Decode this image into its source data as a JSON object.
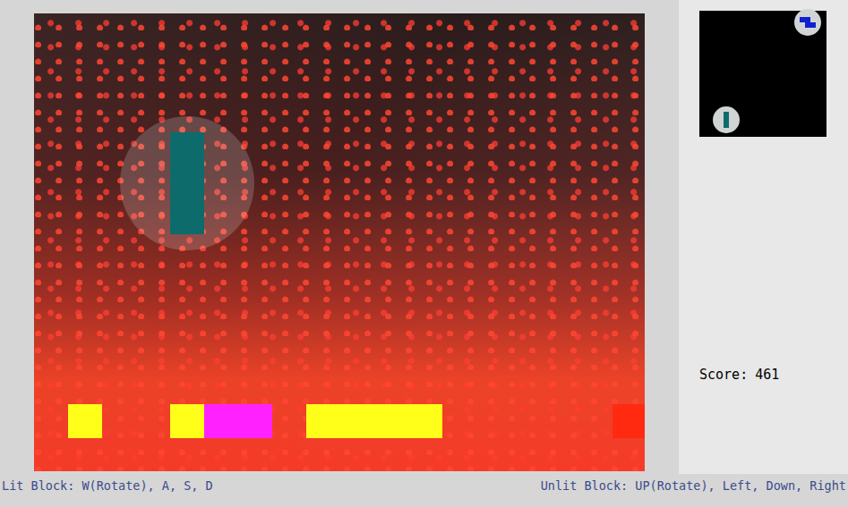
{
  "board": {
    "cells": [
      {
        "col": 1,
        "row": 12,
        "color": "#ffff1a"
      },
      {
        "col": 4,
        "row": 12,
        "color": "#ffff1a"
      },
      {
        "col": 5,
        "row": 12,
        "color": "#ff22ff"
      },
      {
        "col": 6,
        "row": 12,
        "color": "#ff22ff"
      },
      {
        "col": 8,
        "row": 12,
        "color": "#ffff1a"
      },
      {
        "col": 9,
        "row": 12,
        "color": "#ffff1a"
      },
      {
        "col": 10,
        "row": 12,
        "color": "#ffff1a"
      },
      {
        "col": 11,
        "row": 12,
        "color": "#ffff1a"
      },
      {
        "col": 17,
        "row": 12,
        "color": "#ff2a10"
      }
    ],
    "active_piece": {
      "lit": true,
      "color": "#0e6b6b",
      "cells": [
        [
          4,
          4
        ],
        [
          4,
          5
        ],
        [
          4,
          6
        ]
      ]
    }
  },
  "preview": {
    "pieces": [
      {
        "color": "#1020d0",
        "cells": [
          [
            0,
            0
          ],
          [
            1,
            0
          ],
          [
            1,
            1
          ],
          [
            2,
            1
          ]
        ]
      },
      {
        "color": "#0e6b6b",
        "cells": [
          [
            0,
            0
          ],
          [
            0,
            1
          ],
          [
            0,
            2
          ]
        ]
      }
    ]
  },
  "score": {
    "label": "Score:",
    "value": "461"
  },
  "controls": [
    "Lit Block: W(Rotate), A, S, D",
    "Unlit Block: UP(Rotate), Left, Down, Right"
  ]
}
